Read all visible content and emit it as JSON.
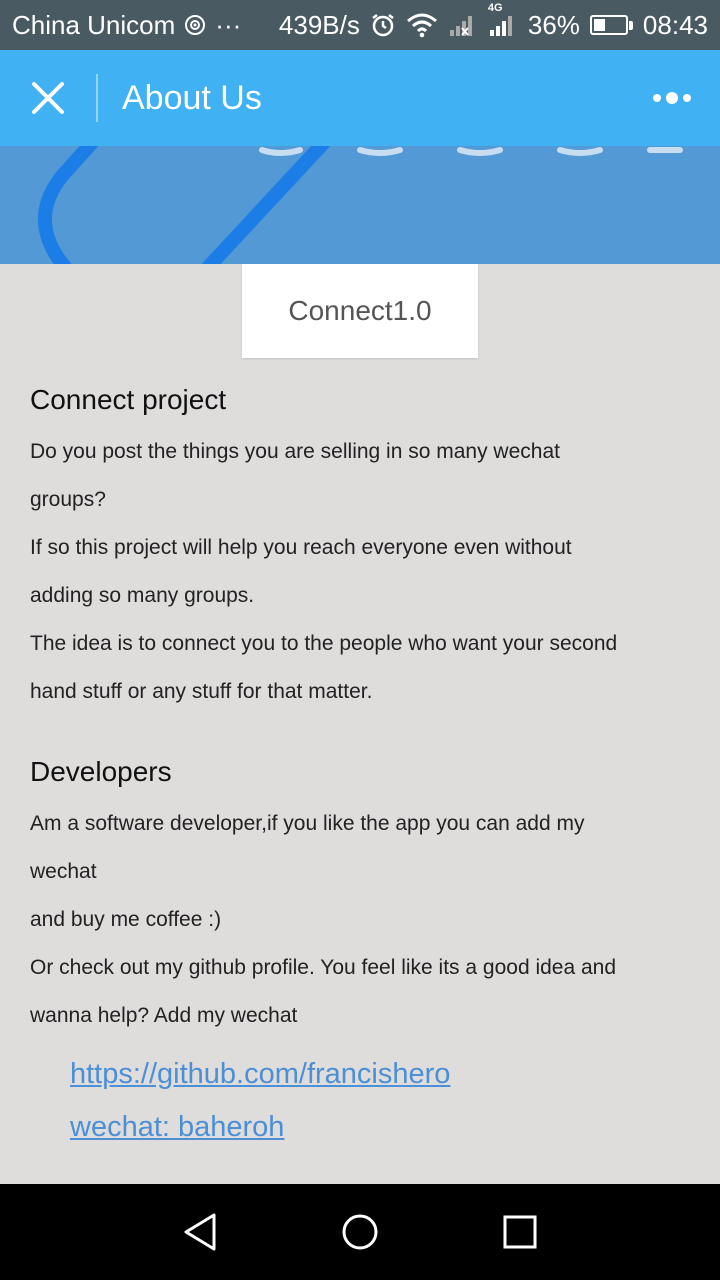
{
  "status_bar": {
    "carrier": "China Unicom",
    "ellipsis": "···",
    "speed": "439B/s",
    "network_label": "4G",
    "battery": "36%",
    "battery_level": 0.36,
    "time": "08:43",
    "icons": [
      "target-icon",
      "alarm-icon",
      "wifi-icon",
      "signal-x-icon",
      "signal-icon",
      "battery-icon"
    ]
  },
  "nav": {
    "title": "About Us",
    "close_icon": "close-icon",
    "more_icon": "more-icon"
  },
  "version_card": {
    "label": "Connect1.0"
  },
  "sections": {
    "project": {
      "title": "Connect project",
      "paragraphs": [
        "Do you post the things you are selling in so many wechat",
        "groups?",
        "If so this project will help you reach everyone even without",
        "adding so many groups.",
        "The idea is to connect you to the people who want your second",
        "hand stuff or any stuff for that matter."
      ]
    },
    "developers": {
      "title": "Developers",
      "paragraphs": [
        "Am a software developer,if you like the app you can add my",
        "wechat",
        "and buy me coffee :)",
        "Or check out my github profile. You feel like its a good idea and",
        "wanna help? Add my wechat"
      ],
      "links": [
        "https://github.com/francishero",
        "wechat: baheroh"
      ]
    }
  },
  "colors": {
    "status_bar": "#4a5a63",
    "nav_bar": "#40b1f2",
    "banner": "#5399d6",
    "background": "#dfdcdc",
    "link": "#4b8fd6"
  },
  "system_nav": {
    "icons": [
      "back-icon",
      "home-icon",
      "recents-icon"
    ]
  }
}
